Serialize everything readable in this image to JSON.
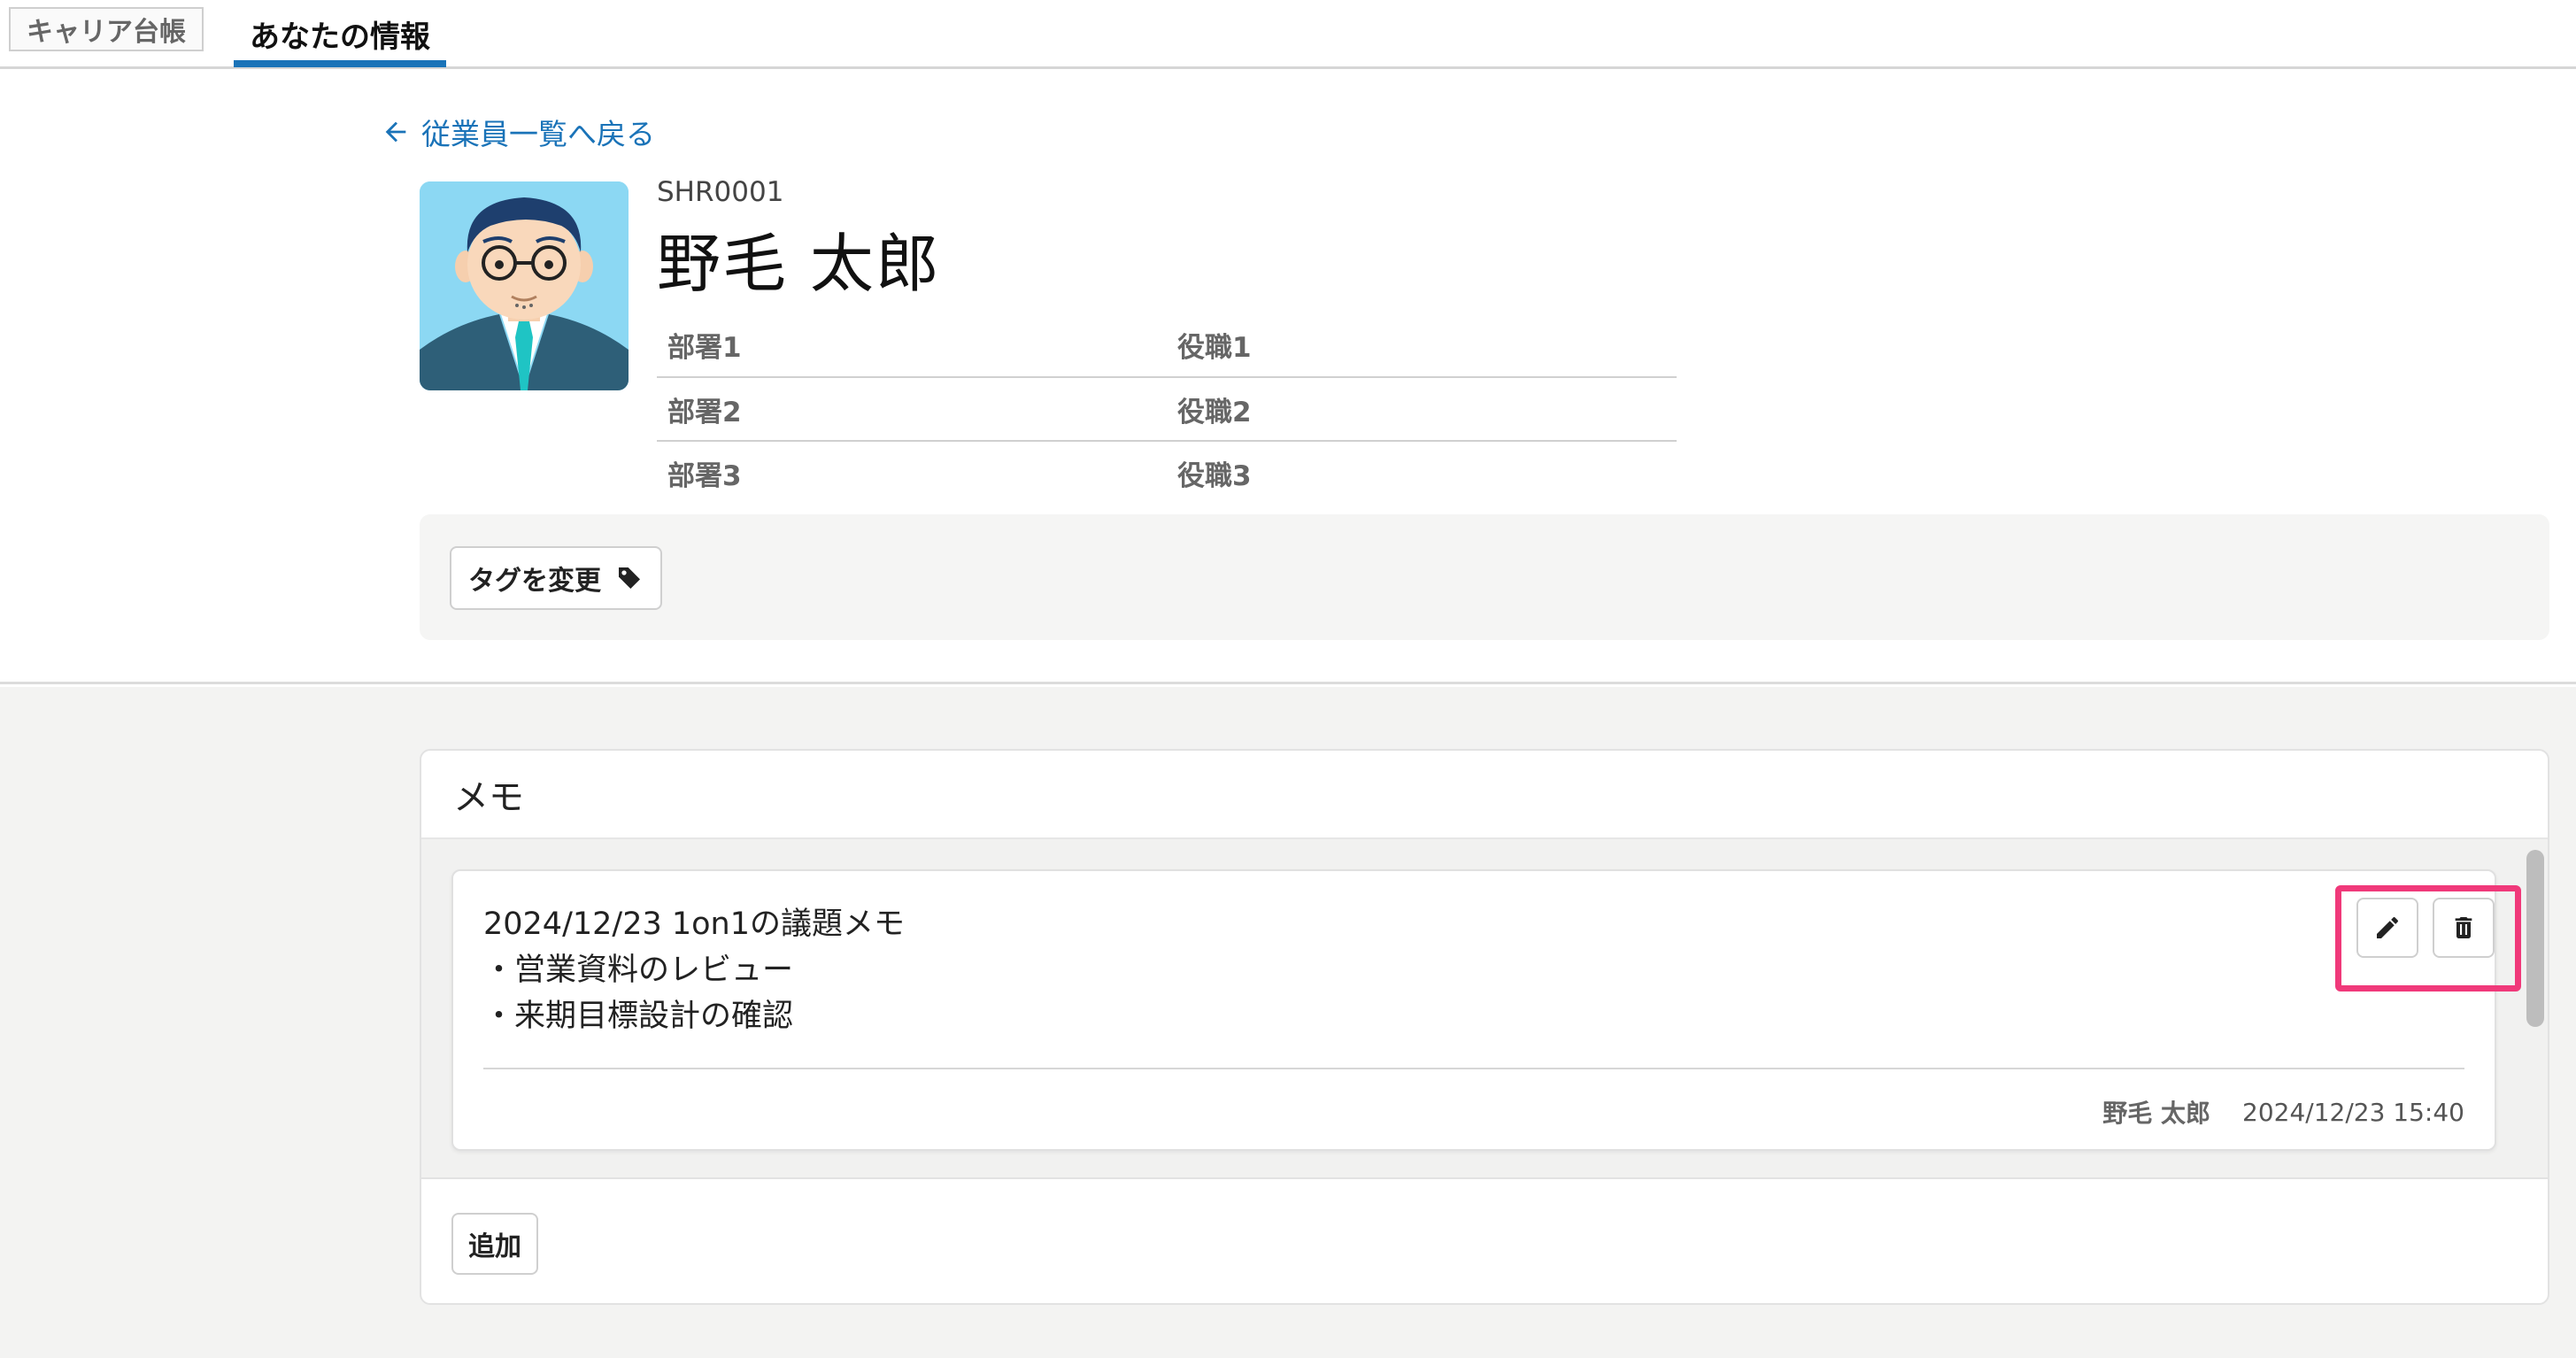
{
  "tabs": {
    "career": "キャリア台帳",
    "info": "あなたの情報"
  },
  "back_link": "従業員一覧へ戻る",
  "employee": {
    "code": "SHR0001",
    "name": "野毛 太郎",
    "rows": [
      {
        "dept": "部署1",
        "role": "役職1"
      },
      {
        "dept": "部署2",
        "role": "役職2"
      },
      {
        "dept": "部署3",
        "role": "役職3"
      }
    ]
  },
  "tag_button": "タグを変更",
  "memo": {
    "title": "メモ",
    "items": [
      {
        "lines": [
          "2024/12/23 1on1の議題メモ",
          "・営業資料のレビュー",
          "・来期目標設計の確認"
        ],
        "author": "野毛 太郎",
        "timestamp": "2024/12/23 15:40"
      }
    ],
    "add_label": "追加"
  },
  "colors": {
    "accent": "#1a73b8",
    "highlight": "#f0397a"
  },
  "icons": [
    "arrow-left-icon",
    "tag-icon",
    "pencil-icon",
    "trash-icon",
    "avatar-illustration"
  ]
}
